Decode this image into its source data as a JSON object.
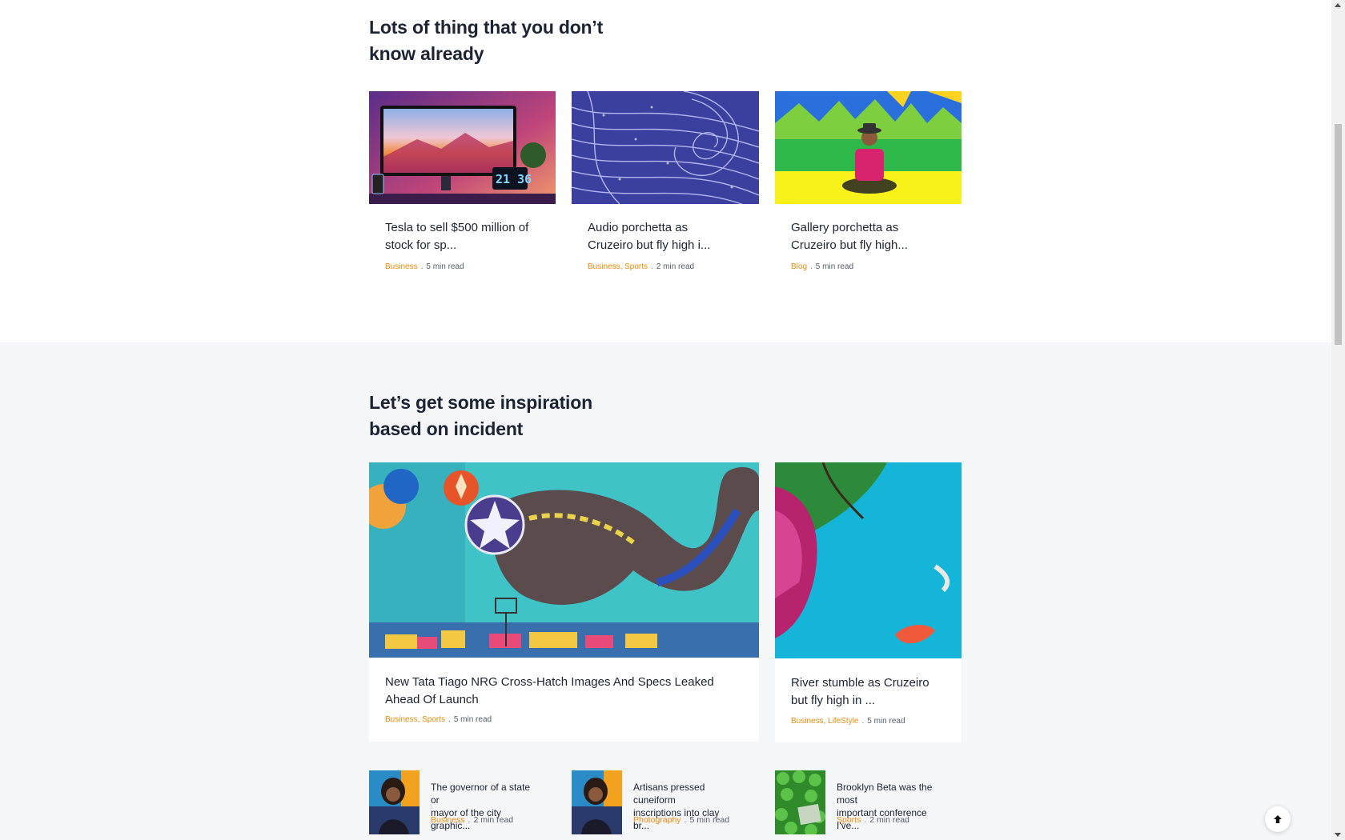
{
  "section1": {
    "heading_line1": "Lots of thing that you don’t",
    "heading_line2": "know already",
    "cards": [
      {
        "image": "monitor-desk-photo",
        "title_line1": "Tesla to sell $500 million of",
        "title_line2": "stock for sp...",
        "categories": "Business",
        "read_time": "5 min read"
      },
      {
        "image": "abstract-blue-lines-photo",
        "title_line1": "Audio porchetta as",
        "title_line2": "Cruzeiro but fly high i...",
        "categories": "Business, Sports",
        "read_time": "2 min read"
      },
      {
        "image": "man-sitting-colorful-wall-photo",
        "title_line1": "Gallery porchetta as",
        "title_line2": "Cruzeiro but fly high...",
        "categories": "Blog",
        "read_time": "5 min read"
      }
    ]
  },
  "section2": {
    "heading_line1": "Let’s get some inspiration",
    "heading_line2": "based on incident",
    "feature_cards": [
      {
        "image": "elephant-mural-photo",
        "title_line1": "New Tata Tiago NRG Cross-Hatch Images And Specs Leaked",
        "title_line2": "Ahead Of Launch",
        "categories": "Business, Sports",
        "read_time": "5 min read"
      },
      {
        "image": "toy-dinosaur-blue-photo",
        "title_line1": "River stumble as Cruzeiro",
        "title_line2": "but fly high in ...",
        "categories": "Business, LifeStyle",
        "read_time": "5 min read"
      }
    ],
    "mini_cards": [
      {
        "image": "portrait-colorful-photo",
        "title_line1": "The governor of a state or",
        "title_line2": "mayor of the city graphic...",
        "categories": "Business",
        "read_time": "2 min read"
      },
      {
        "image": "portrait-colorful-photo",
        "title_line1": "Artisans pressed cuneiform",
        "title_line2": "inscriptions into clay br...",
        "categories": "Photography",
        "read_time": "5 min read"
      },
      {
        "image": "green-leaves-sign-photo",
        "title_line1": "Brooklyn Beta was the most",
        "title_line2": "important conference I've...",
        "categories": "Sports",
        "read_time": "2 min read"
      }
    ]
  },
  "meta_separator": ".",
  "colors": {
    "accent": "#f08a0a",
    "heading": "#1c2333",
    "section_bg": "#f5f6f8"
  },
  "icons": {
    "back_to_top": "arrow-up-icon"
  }
}
